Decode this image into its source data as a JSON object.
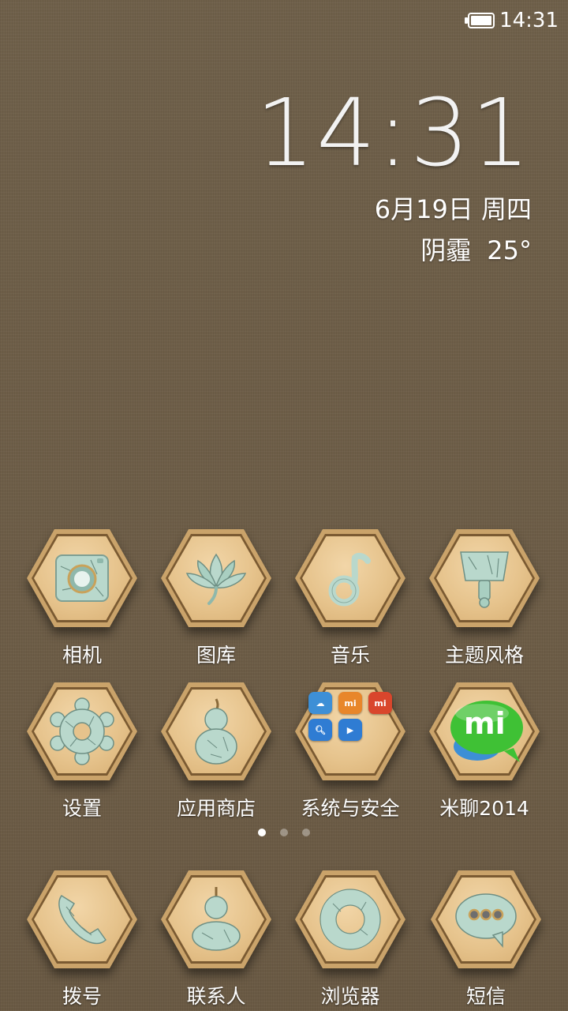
{
  "status_bar": {
    "time": "14:31"
  },
  "clock": {
    "time": "14:31",
    "date": "6月19日 周四",
    "weather": "阴霾",
    "temperature": "25°"
  },
  "apps_row1": [
    {
      "label": "相机",
      "icon": "camera-icon"
    },
    {
      "label": "图库",
      "icon": "lotus-icon"
    },
    {
      "label": "音乐",
      "icon": "music-note-icon"
    },
    {
      "label": "主题风格",
      "icon": "paintbrush-icon"
    }
  ],
  "apps_row2": [
    {
      "label": "设置",
      "icon": "gear-icon"
    },
    {
      "label": "应用商店",
      "icon": "gourd-icon"
    },
    {
      "label": "系统与安全",
      "icon": "folder-icon"
    },
    {
      "label": "米聊2014",
      "icon": "mitalk-icon",
      "icon_text": "mi"
    }
  ],
  "dock": [
    {
      "label": "拨号",
      "icon": "phone-icon"
    },
    {
      "label": "联系人",
      "icon": "contact-gourd-icon"
    },
    {
      "label": "浏览器",
      "icon": "ring-icon"
    },
    {
      "label": "短信",
      "icon": "message-bubble-icon"
    }
  ],
  "page_indicator": {
    "pages": 3,
    "current": 1
  },
  "folder_minis": [
    {
      "text": "",
      "color": "#3d8fd6"
    },
    {
      "text": "mi",
      "color": "#e8862a"
    },
    {
      "text": "mi",
      "color": "#d9462c"
    },
    {
      "text": "",
      "color": "#2f7cd3"
    },
    {
      "text": "",
      "color": "#2f7cd3"
    }
  ],
  "colors": {
    "porcelain": "#b9d8cc",
    "wood": "#e6c38c",
    "mitalk_green": "#3fc135"
  }
}
